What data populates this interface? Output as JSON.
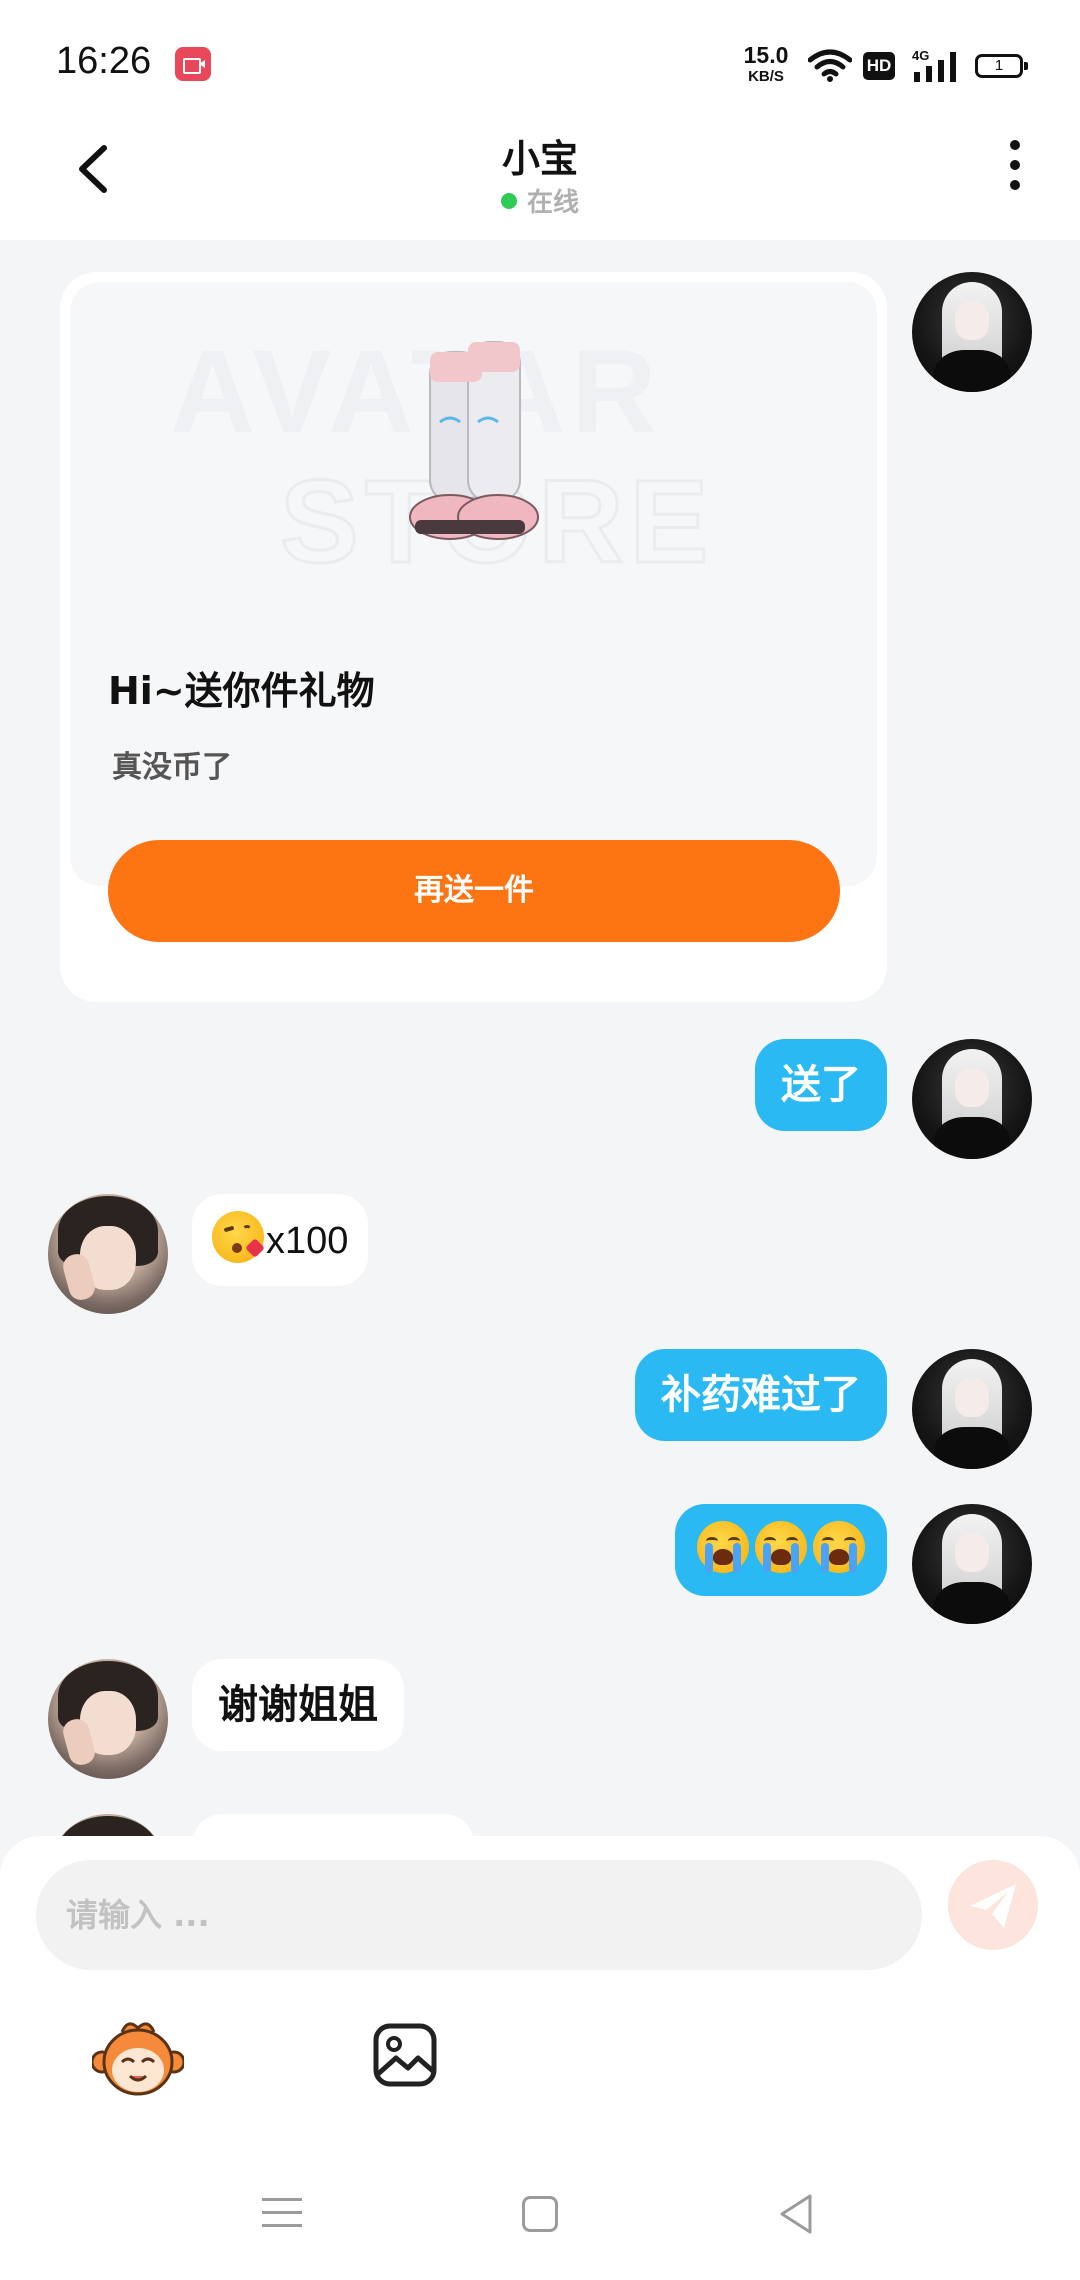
{
  "status_bar": {
    "time": "16:26",
    "net_speed_value": "15.0",
    "net_speed_unit": "KB/S",
    "hd_label": "HD",
    "network_label": "4G",
    "battery_label": "1"
  },
  "header": {
    "title": "小宝",
    "status": "在线"
  },
  "gift_card": {
    "image_watermark_line1": "AVATAR",
    "image_watermark_line2": "STORE",
    "title": "Hi~送你件礼物",
    "subtitle": "真没币了",
    "button_label": "再送一件"
  },
  "messages": [
    {
      "side": "out",
      "text": "送了"
    },
    {
      "side": "in",
      "emoji": "kissing-face-emoji",
      "text": "x100"
    },
    {
      "side": "out",
      "text": "补药难过了"
    },
    {
      "side": "out",
      "emoji": "loudly-crying-face-emoji",
      "emoji_count": 3
    },
    {
      "side": "in",
      "text": "谢谢姐姐"
    }
  ],
  "input": {
    "placeholder": "请输入 ..."
  },
  "colors": {
    "accent_orange": "#fd7413",
    "bubble_blue": "#2ab9f2",
    "online_green": "#2ecc55",
    "background": "#f4f5f7"
  }
}
